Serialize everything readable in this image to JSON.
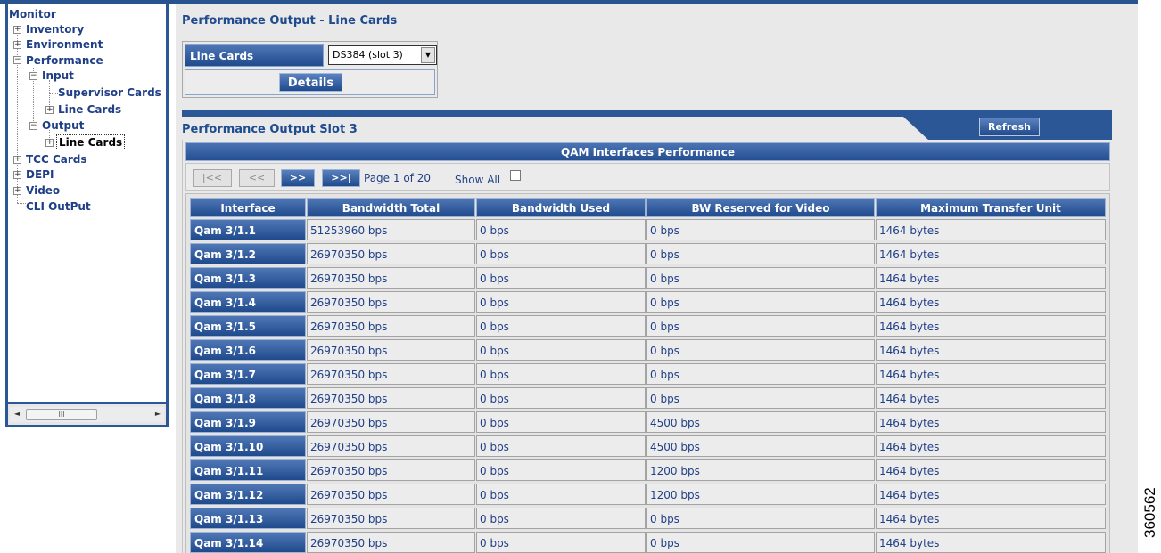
{
  "tree": {
    "monitor": "Monitor",
    "inventory": "Inventory",
    "environment": "Environment",
    "performance": "Performance",
    "input": "Input",
    "supervisor_cards": "Supervisor Cards",
    "input_line_cards": "Line Cards",
    "output": "Output",
    "output_line_cards": "Line Cards",
    "tcc_cards": "TCC Cards",
    "depi": "DEPI",
    "video": "Video",
    "cli_output": "CLI OutPut",
    "expand_glyph": "+",
    "collapse_glyph": "−"
  },
  "scrollbar": {
    "left_arrow": "◄",
    "right_arrow": "►",
    "thumb_grip": "III"
  },
  "header": {
    "title": "Performance Output - Line Cards"
  },
  "line_cards": {
    "label": "Line Cards",
    "selected_value": "DS384 (slot 3)",
    "dropdown_glyph": "▼",
    "details_label": "Details"
  },
  "slot": {
    "title": "Performance Output Slot 3",
    "refresh_label": "Refresh"
  },
  "qam": {
    "title": "QAM Interfaces Performance",
    "pager": {
      "first": "|<<",
      "prev": "<<",
      "next": ">>",
      "last": ">>|",
      "page_text": "Page 1 of 20",
      "show_all": "Show All"
    },
    "columns": [
      "Interface",
      "Bandwidth Total",
      "Bandwidth Used",
      "BW Reserved for Video",
      "Maximum Transfer Unit"
    ],
    "rows": [
      [
        "Qam 3/1.1",
        "51253960 bps",
        "0 bps",
        "0 bps",
        "1464 bytes"
      ],
      [
        "Qam 3/1.2",
        "26970350 bps",
        "0 bps",
        "0 bps",
        "1464 bytes"
      ],
      [
        "Qam 3/1.3",
        "26970350 bps",
        "0 bps",
        "0 bps",
        "1464 bytes"
      ],
      [
        "Qam 3/1.4",
        "26970350 bps",
        "0 bps",
        "0 bps",
        "1464 bytes"
      ],
      [
        "Qam 3/1.5",
        "26970350 bps",
        "0 bps",
        "0 bps",
        "1464 bytes"
      ],
      [
        "Qam 3/1.6",
        "26970350 bps",
        "0 bps",
        "0 bps",
        "1464 bytes"
      ],
      [
        "Qam 3/1.7",
        "26970350 bps",
        "0 bps",
        "0 bps",
        "1464 bytes"
      ],
      [
        "Qam 3/1.8",
        "26970350 bps",
        "0 bps",
        "0 bps",
        "1464 bytes"
      ],
      [
        "Qam 3/1.9",
        "26970350 bps",
        "0 bps",
        "4500 bps",
        "1464 bytes"
      ],
      [
        "Qam 3/1.10",
        "26970350 bps",
        "0 bps",
        "4500 bps",
        "1464 bytes"
      ],
      [
        "Qam 3/1.11",
        "26970350 bps",
        "0 bps",
        "1200 bps",
        "1464 bytes"
      ],
      [
        "Qam 3/1.12",
        "26970350 bps",
        "0 bps",
        "1200 bps",
        "1464 bytes"
      ],
      [
        "Qam 3/1.13",
        "26970350 bps",
        "0 bps",
        "0 bps",
        "1464 bytes"
      ],
      [
        "Qam 3/1.14",
        "26970350 bps",
        "0 bps",
        "0 bps",
        "1464 bytes"
      ]
    ]
  },
  "figure_id": "360562",
  "colors": {
    "brand_blue": "#2b5796",
    "text_blue": "#1f3f86",
    "panel_gray": "#e9e9e9"
  }
}
